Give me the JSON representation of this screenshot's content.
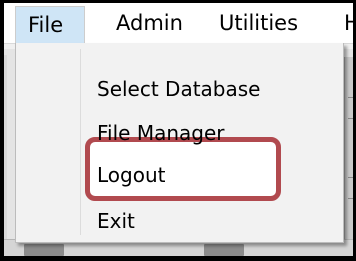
{
  "menubar": {
    "items": [
      {
        "label": "File"
      },
      {
        "label": "Admin"
      },
      {
        "label": "Utilities"
      },
      {
        "label": "H"
      }
    ]
  },
  "file_menu": {
    "items": [
      {
        "label": "Select Database"
      },
      {
        "label": "File Manager"
      },
      {
        "label": "Logout"
      },
      {
        "label": "Exit"
      }
    ]
  },
  "colors": {
    "highlight_border": "#b14a4f",
    "active_menu_bg": "#cfe5f6"
  }
}
